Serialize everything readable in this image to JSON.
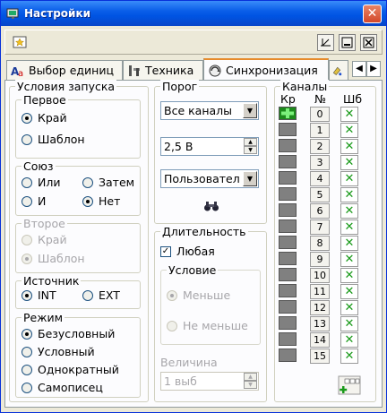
{
  "window": {
    "title": "Настройки",
    "close_glyph": "✕"
  },
  "toolbar": {
    "left_icon": "star-page-icon",
    "btn_icons": [
      "dock-icon",
      "minimize-icon",
      "close-icon"
    ]
  },
  "tabs": [
    {
      "label": "Выбор единиц",
      "icon": "units-icon"
    },
    {
      "label": "Техника",
      "icon": "tools-icon"
    },
    {
      "label": "Синхронизация",
      "icon": "sync-icon",
      "active": true
    },
    {
      "label": "",
      "icon": "paint-icon"
    }
  ],
  "tab_scroll": {
    "left": "◀",
    "right": "▶"
  },
  "launch": {
    "title": "Условия запуска",
    "first": {
      "title": "Первое",
      "options": [
        "Край",
        "Шаблон"
      ],
      "selected": 0
    },
    "union": {
      "title": "Союз",
      "options": [
        "Или",
        "Затем",
        "И",
        "Нет"
      ],
      "selected": 3
    },
    "second": {
      "title": "Второе",
      "options": [
        "Край",
        "Шаблон"
      ],
      "selected": 1
    },
    "source": {
      "title": "Источник",
      "options": [
        "INT",
        "EXT"
      ],
      "selected": 0
    },
    "mode": {
      "title": "Режим",
      "options": [
        "Безусловный",
        "Условный",
        "Однократный",
        "Самописец"
      ],
      "selected": 0
    }
  },
  "threshold": {
    "title": "Порог",
    "channels_value": "Все каналы",
    "level_value": "2,5 В",
    "type_value": "Пользовател",
    "find_icon": "binoculars-icon"
  },
  "duration": {
    "title": "Длительность",
    "any_label": "Любая",
    "any_checked": true,
    "condition": {
      "title": "Условие",
      "options": [
        "Меньше",
        "Не меньше"
      ],
      "selected": 0
    },
    "magnitude_label": "Величина",
    "magnitude_value": "1 выб"
  },
  "channels": {
    "title": "Каналы",
    "headers": [
      "Кр",
      "№",
      "Шб"
    ],
    "numbers": [
      "0",
      "1",
      "2",
      "3",
      "4",
      "5",
      "6",
      "7",
      "8",
      "9",
      "10",
      "11",
      "12",
      "13",
      "14",
      "15"
    ],
    "x_glyph": "✕",
    "add_icon": "add-channel-icon"
  }
}
